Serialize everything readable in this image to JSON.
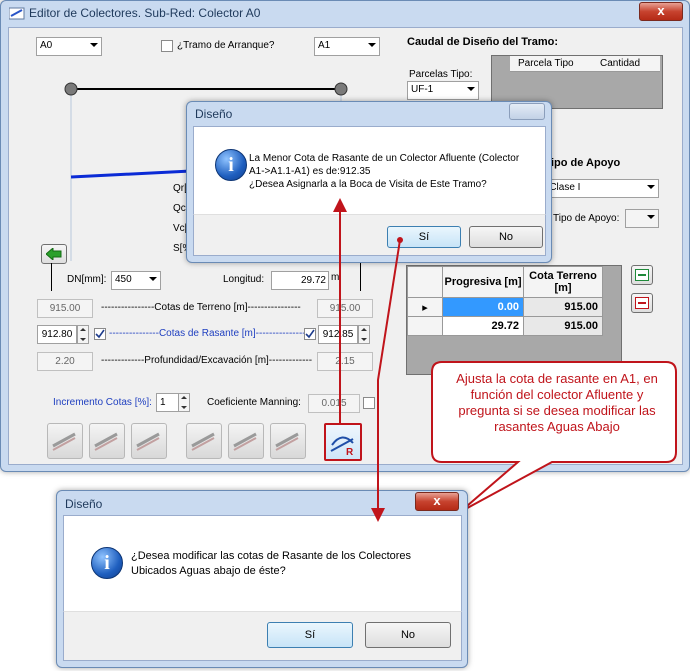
{
  "main_window": {
    "title": "Editor de Colectores. Sub-Red: Colector A0",
    "close": "x"
  },
  "left_panel": {
    "start_node": "A0",
    "end_node": "A1",
    "tramo_arranque_label": "¿Tramo de Arranque?",
    "hydraulic_labels": [
      "Qr[l",
      "Qc[",
      "Vc[",
      "S[%"
    ],
    "dn_label": "DN[mm]:",
    "dn_value": "450",
    "longitud_label": "Longitud:",
    "longitud_value": "29.72",
    "longitud_unit": "m",
    "terreno_left": "915.00",
    "terreno_label": "----------------Cotas de Terreno [m]----------------",
    "terreno_right": "915.00",
    "rasante_left": "912.80",
    "rasante_label": "---------------Cotas de Rasante [m]---------------",
    "rasante_right": "912.85",
    "profundidad_left": "2.20",
    "profundidad_label": "-------------Profundidad/Excavación [m]-------------",
    "profundidad_right": "2.15",
    "incremento_label": "Incremento Cotas [%]:",
    "incremento_value": "1",
    "manning_label": "Coeficiente Manning:",
    "manning_value": "0.015"
  },
  "right_panel": {
    "caudal_title": "Caudal de Diseño del Tramo:",
    "parcelas_label": "Parcelas Tipo:",
    "parcelas_value": "UF-1",
    "parcela_columns": [
      "Parcela Tipo",
      "Cantidad"
    ],
    "apoyo_title": "ipo de Apoyo",
    "apoyo_value": "o Clase I",
    "tipo_apoyo_label": "Tipo de Apoyo:",
    "profile_columns": [
      "Progresiva [m]",
      "Cota Terreno [m]"
    ],
    "profile_rows": [
      {
        "marker": "▸",
        "progresiva": "0.00",
        "cota": "915.00"
      },
      {
        "marker": "",
        "progresiva": "29.72",
        "cota": "915.00"
      }
    ]
  },
  "dialog1": {
    "title": "Diseño",
    "message_line1": "La Menor Cota de Rasante de un Colector Afluente (Colector",
    "message_line2": "A1->A1.1-A1) es de:912.35",
    "message_line3": "¿Desea Asignarla a la Boca de Visita de Este Tramo?",
    "yes": "Sí",
    "no": "No"
  },
  "callout": {
    "text": "Ajusta la cota de rasante en A1, en función del colector Afluente y pregunta si se desea modificar las rasantes Aguas Abajo"
  },
  "dialog2": {
    "title": "Diseño",
    "close": "x",
    "message_line1": "¿Desea modificar las cotas de Rasante de los Colectores",
    "message_line2": "Ubicados Aguas abajo de éste?",
    "yes": "Sí",
    "no": "No"
  },
  "colors": {
    "window_frame": "#c9daf0",
    "pipe_blue": "#0b2bd6",
    "annotation_red": "#c0141b",
    "selection_blue": "#3399ff",
    "link_blue": "#2040c0"
  }
}
